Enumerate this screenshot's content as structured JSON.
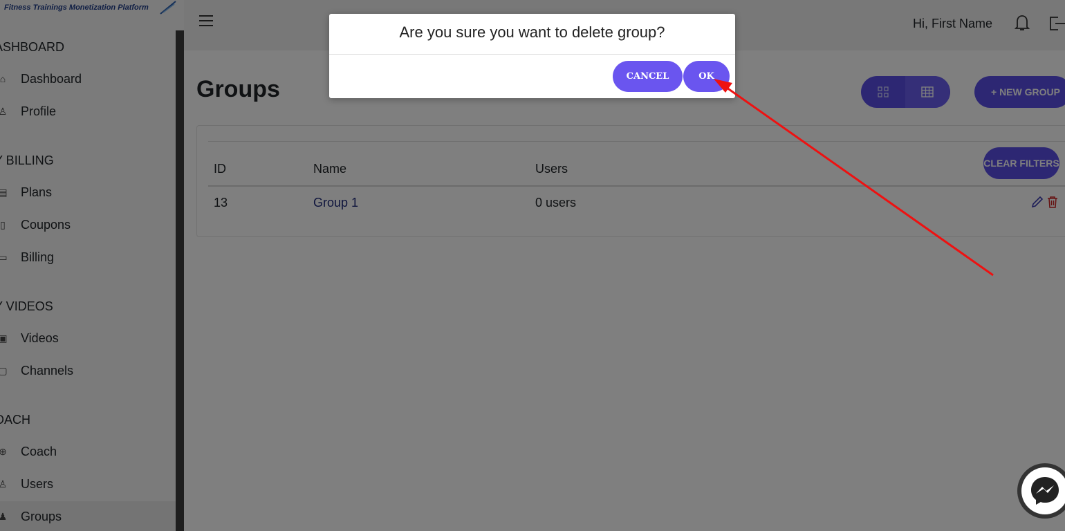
{
  "app": {
    "logo_tagline": "Fitness Trainings Monetization Platform"
  },
  "sidebar": {
    "sections": [
      {
        "title": "ASHBOARD",
        "items": [
          {
            "label": "Dashboard",
            "icon": "home-icon"
          },
          {
            "label": "Profile",
            "icon": "user-icon"
          }
        ]
      },
      {
        "title": "Y BILLING",
        "items": [
          {
            "label": "Plans",
            "icon": "list-icon"
          },
          {
            "label": "Coupons",
            "icon": "coupon-icon"
          },
          {
            "label": "Billing",
            "icon": "card-icon"
          }
        ]
      },
      {
        "title": "Y VIDEOS",
        "items": [
          {
            "label": "Videos",
            "icon": "video-icon"
          },
          {
            "label": "Channels",
            "icon": "channel-icon"
          }
        ]
      },
      {
        "title": "OACH",
        "items": [
          {
            "label": "Coach",
            "icon": "globe-icon"
          },
          {
            "label": "Users",
            "icon": "users-icon"
          },
          {
            "label": "Groups",
            "icon": "group-icon",
            "active": true
          }
        ]
      }
    ]
  },
  "header": {
    "greeting": "Hi, First Name"
  },
  "page": {
    "title": "Groups",
    "new_group_label": "+ NEW GROUP",
    "clear_filters_label": "CLEAR FILTERS"
  },
  "table": {
    "columns": [
      "ID",
      "Name",
      "Users"
    ],
    "rows": [
      {
        "id": "13",
        "name": "Group 1",
        "users": "0 users"
      }
    ]
  },
  "modal": {
    "title": "Are you sure you want to delete group?",
    "cancel_label": "CANCEL",
    "ok_label": "OK"
  },
  "colors": {
    "accent": "#5b4fe6",
    "annotation_arrow": "#ee1111",
    "trash": "#cc2222"
  }
}
